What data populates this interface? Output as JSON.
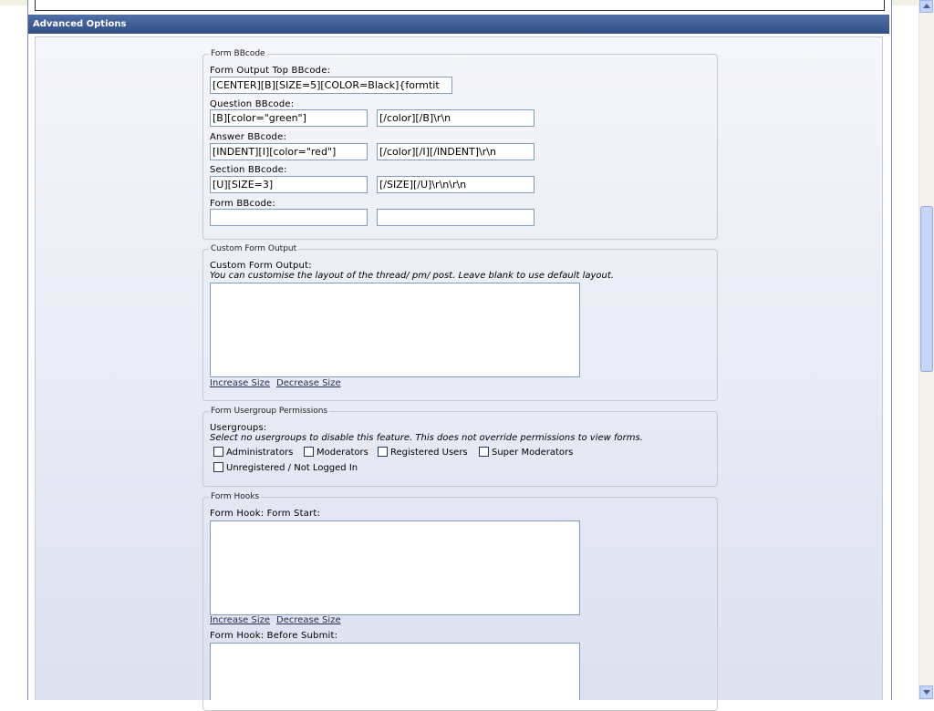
{
  "section": {
    "title": "Advanced Options"
  },
  "form_bbcode": {
    "legend": "Form BBcode",
    "top_label": "Form Output Top BBcode:",
    "top_value": "[CENTER][B][SIZE=5][COLOR=Black]{formtit",
    "question_label": "Question BBcode:",
    "question_open": "[B][color=\"green\"]",
    "question_close": "[/color][/B]\\r\\n",
    "answer_label": "Answer BBcode:",
    "answer_open": "[INDENT][I][color=\"red\"]",
    "answer_close": "[/color][/I][/INDENT]\\r\\n",
    "section_label": "Section BBcode:",
    "section_open": "[U][SIZE=3]",
    "section_close": "[/SIZE][/U]\\r\\n\\r\\n",
    "form_label": "Form BBcode:",
    "form_open": "",
    "form_close": ""
  },
  "custom_output": {
    "legend": "Custom Form Output",
    "label": "Custom Form Output:",
    "description": "You can customise the layout of the thread/ pm/ post. Leave blank to use default layout.",
    "value": "",
    "increase": "Increase Size",
    "decrease": "Decrease Size"
  },
  "permissions": {
    "legend": "Form Usergroup Permissions",
    "label": "Usergroups:",
    "description": "Select no usergroups to disable this feature. This does not override permissions to view forms.",
    "groups": [
      "Administrators",
      "Moderators",
      "Registered Users",
      "Super Moderators",
      "Unregistered / Not Logged In"
    ]
  },
  "hooks": {
    "legend": "Form Hooks",
    "start_label": "Form Hook: Form Start:",
    "start_value": "",
    "increase": "Increase Size",
    "decrease": "Decrease Size",
    "before_submit_label": "Form Hook: Before Submit:",
    "before_submit_value": ""
  },
  "icons": {
    "scroll_up": "triangle-up-icon",
    "scroll_down": "triangle-down-icon"
  },
  "colors": {
    "header_bg": "#3a5a92",
    "input_border": "#7f9db9",
    "link": "#22314f"
  }
}
